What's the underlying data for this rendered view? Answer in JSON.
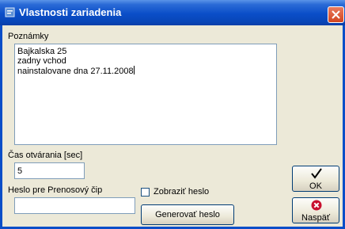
{
  "window": {
    "title": "Vlastnosti zariadenia"
  },
  "notes": {
    "label": "Poznámky",
    "lines": [
      "Bajkalska 25",
      "zadny vchod",
      "nainstalovane dna 27.11.2008"
    ]
  },
  "open_time": {
    "label": "Čas otvárania [sec]",
    "value": "5"
  },
  "password": {
    "label": "Heslo pre Prenosový čip",
    "value": "",
    "show_password_label": "Zobraziť heslo",
    "generate_label": "Generovať heslo"
  },
  "buttons": {
    "ok_label": "OK",
    "back_label": "Naspäť"
  }
}
